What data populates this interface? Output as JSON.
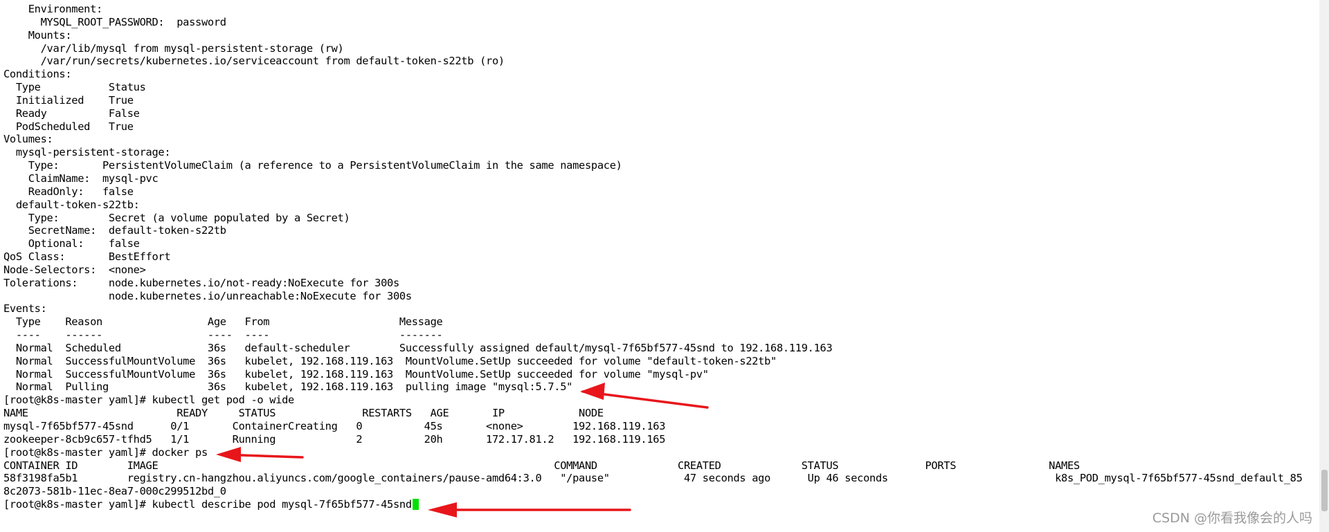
{
  "terminal": {
    "lines": [
      "    Environment:",
      "      MYSQL_ROOT_PASSWORD:  password",
      "    Mounts:",
      "      /var/lib/mysql from mysql-persistent-storage (rw)",
      "      /var/run/secrets/kubernetes.io/serviceaccount from default-token-s22tb (ro)",
      "Conditions:",
      "  Type           Status",
      "  Initialized    True",
      "  Ready          False",
      "  PodScheduled   True",
      "Volumes:",
      "  mysql-persistent-storage:",
      "    Type:       PersistentVolumeClaim (a reference to a PersistentVolumeClaim in the same namespace)",
      "    ClaimName:  mysql-pvc",
      "    ReadOnly:   false",
      "  default-token-s22tb:",
      "    Type:        Secret (a volume populated by a Secret)",
      "    SecretName:  default-token-s22tb",
      "    Optional:    false",
      "QoS Class:       BestEffort",
      "Node-Selectors:  <none>",
      "Tolerations:     node.kubernetes.io/not-ready:NoExecute for 300s",
      "                 node.kubernetes.io/unreachable:NoExecute for 300s",
      "Events:",
      "  Type    Reason                 Age   From                     Message",
      "  ----    ------                 ----  ----                     -------",
      "  Normal  Scheduled              36s   default-scheduler        Successfully assigned default/mysql-7f65bf577-45snd to 192.168.119.163",
      "  Normal  SuccessfulMountVolume  36s   kubelet, 192.168.119.163  MountVolume.SetUp succeeded for volume \"default-token-s22tb\"",
      "  Normal  SuccessfulMountVolume  36s   kubelet, 192.168.119.163  MountVolume.SetUp succeeded for volume \"mysql-pv\"",
      "  Normal  Pulling                36s   kubelet, 192.168.119.163  pulling image \"mysql:5.7.5\"",
      "[root@k8s-master yaml]# kubectl get pod -o wide",
      "NAME                        READY     STATUS              RESTARTS   AGE       IP            NODE",
      "mysql-7f65bf577-45snd      0/1       ContainerCreating   0          45s       <none>        192.168.119.163",
      "zookeeper-8cb9c657-tfhd5   1/1       Running             2          20h       172.17.81.2   192.168.119.165",
      "[root@k8s-master yaml]# docker ps",
      "CONTAINER ID        IMAGE                                                                COMMAND             CREATED             STATUS              PORTS               NAMES",
      "58f3198fa5b1        registry.cn-hangzhou.aliyuncs.com/google_containers/pause-amd64:3.0   \"/pause\"            47 seconds ago      Up 46 seconds                           k8s_POD_mysql-7f65bf577-45snd_default_85",
      "8c2073-581b-11ec-8ea7-000c299512bd_0",
      "[root@k8s-master yaml]# kubectl describe pod mysql-7f65bf577-45snd"
    ]
  },
  "watermark": "CSDN @你看我像会的人吗",
  "colors": {
    "background": "#ffffff",
    "text": "#000000",
    "cursor": "#00e000",
    "arrow": "#e8161b"
  }
}
